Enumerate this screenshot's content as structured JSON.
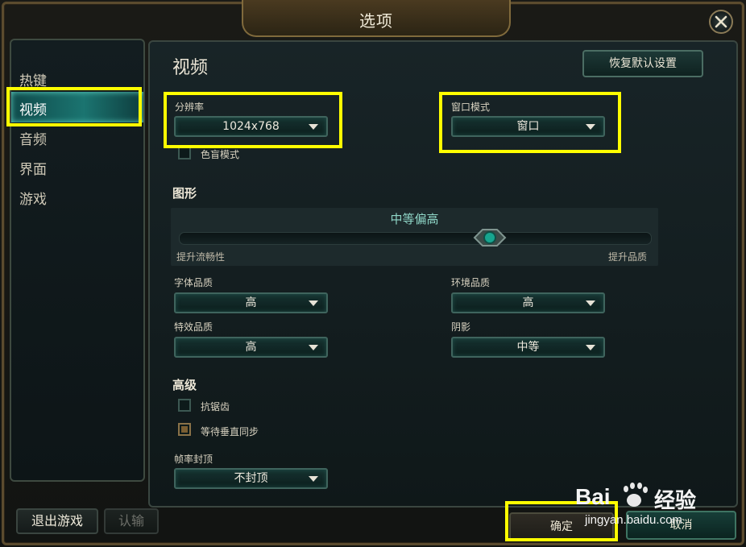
{
  "window": {
    "title": "选项"
  },
  "sidebar": {
    "items": [
      {
        "label": "热键"
      },
      {
        "label": "视频"
      },
      {
        "label": "音频"
      },
      {
        "label": "界面"
      },
      {
        "label": "游戏"
      }
    ]
  },
  "main": {
    "title": "视频",
    "restore_label": "恢复默认设置",
    "resolution": {
      "label": "分辨率",
      "value": "1024x768"
    },
    "window_mode": {
      "label": "窗口模式",
      "value": "窗口"
    },
    "colorblind": {
      "label": "色盲模式",
      "checked": false
    },
    "graphics": {
      "heading": "图形",
      "level": "中等偏高",
      "min_label": "提升流畅性",
      "max_label": "提升品质",
      "level_fraction": 0.66
    },
    "character_quality": {
      "label": "字体品质",
      "value": "高"
    },
    "environment_quality": {
      "label": "环境品质",
      "value": "高"
    },
    "effects_quality": {
      "label": "特效品质",
      "value": "高"
    },
    "shadows": {
      "label": "阴影",
      "value": "中等"
    },
    "advanced": {
      "heading": "高级",
      "antialiasing": {
        "label": "抗锯齿",
        "checked": false
      },
      "vsync": {
        "label": "等待垂直同步",
        "checked": true
      },
      "frame_cap": {
        "label": "帧率封顶",
        "value": "不封顶"
      }
    }
  },
  "footer": {
    "exit_label": "退出游戏",
    "surrender_label": "认输",
    "ok_label": "确定",
    "cancel_label": "取消"
  },
  "watermark": {
    "brand_left": "Bai",
    "brand_right": "经验",
    "url": "jingyan.baidu.com"
  },
  "colors": {
    "highlight": "#ffff00",
    "accent": "#1b7470",
    "slider_value": "#8fd6c7"
  }
}
